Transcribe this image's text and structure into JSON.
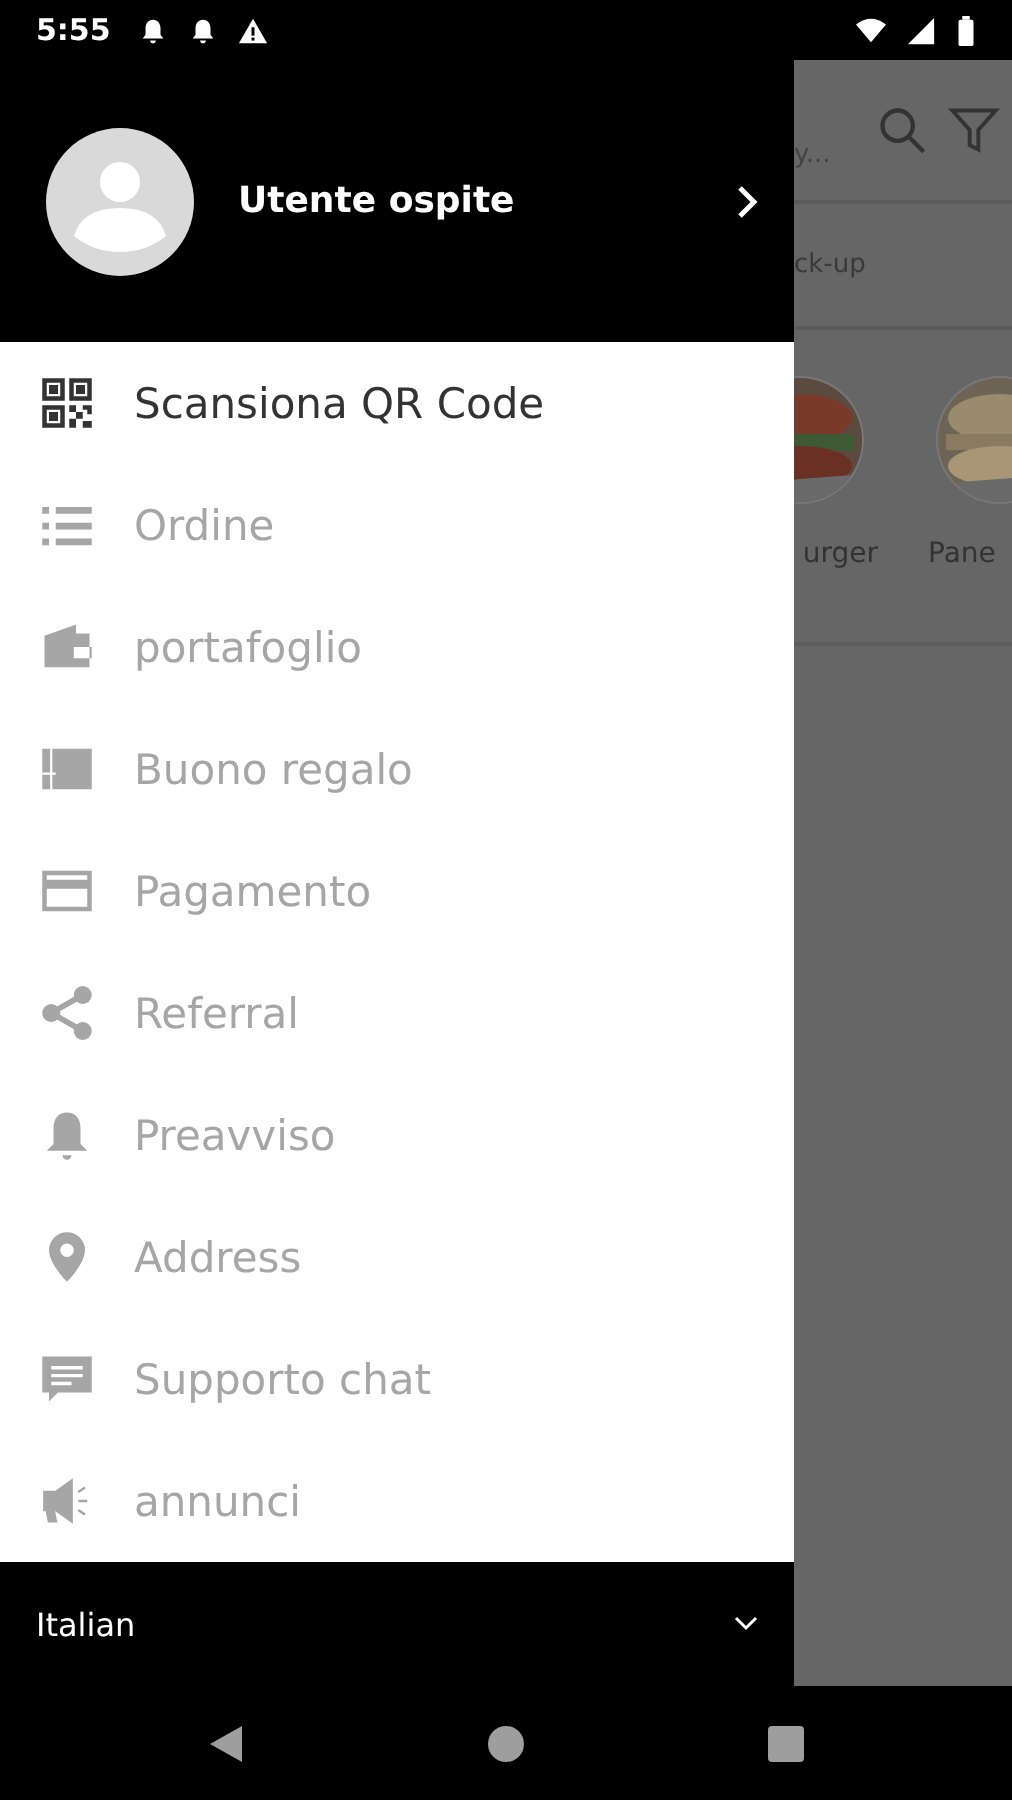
{
  "status_bar": {
    "time": "5:55"
  },
  "drawer": {
    "user": {
      "name": "Utente ospite"
    },
    "items": [
      {
        "label": "Scansiona QR Code",
        "kind": "qr",
        "disabled": false
      },
      {
        "label": "Ordine",
        "kind": "list",
        "disabled": true
      },
      {
        "label": "portafoglio",
        "kind": "wallet",
        "disabled": true
      },
      {
        "label": "Buono regalo",
        "kind": "gift-card",
        "disabled": true
      },
      {
        "label": "Pagamento",
        "kind": "card",
        "disabled": true
      },
      {
        "label": "Referral",
        "kind": "share",
        "disabled": true
      },
      {
        "label": "Preavviso",
        "kind": "bell",
        "disabled": true
      },
      {
        "label": "Address",
        "kind": "pin",
        "disabled": true
      },
      {
        "label": "Supporto chat",
        "kind": "chat",
        "disabled": true
      },
      {
        "label": "annunci",
        "kind": "megaphone",
        "disabled": true
      }
    ],
    "language": "Italian"
  },
  "background_app": {
    "search_text": "y...",
    "tab": "ck-up",
    "categories": [
      {
        "label": "urger",
        "kind": "picture"
      },
      {
        "label": "Pane",
        "kind": "picture"
      }
    ]
  }
}
